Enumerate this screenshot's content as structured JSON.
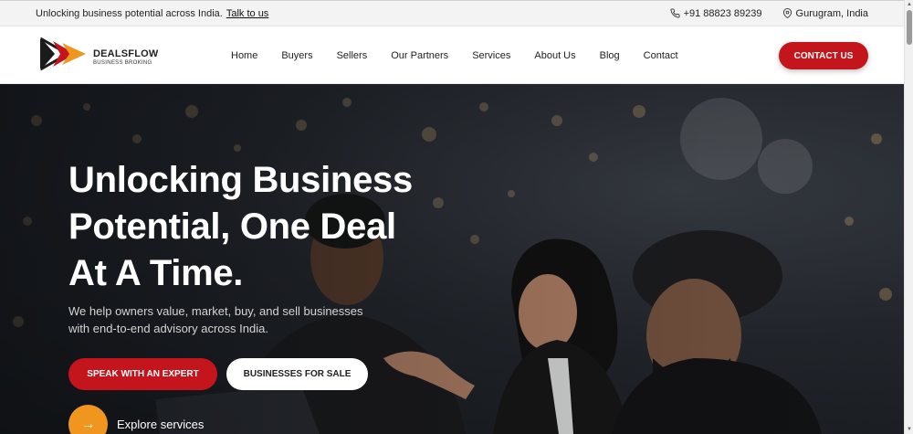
{
  "topbar": {
    "promo_text": "Unlocking business potential across India.",
    "promo_link": "Talk to us",
    "phone": "+91 88823 89239",
    "location": "Gurugram, India"
  },
  "navbar": {
    "brand_name": "DEALSFLOW",
    "brand_tagline": "BUSINESS BROKING",
    "links": [
      "Home",
      "Buyers",
      "Sellers",
      "Our Partners",
      "Services",
      "About Us",
      "Blog",
      "Contact"
    ],
    "contact_button": "CONTACT US"
  },
  "hero": {
    "headline": "Unlocking Business Potential, One Deal At A Time.",
    "subtext": "We help owners value, market, buy, and sell businesses with end-to-end advisory across India.",
    "primary_cta": "SPEAK WITH AN EXPERT",
    "secondary_cta": "BUSINESSES FOR SALE",
    "explore_label": "Explore services"
  },
  "icons": {
    "phone": "phone-icon",
    "location": "location-pin-icon",
    "arrow": "arrow-right-icon"
  },
  "colors": {
    "accent_red": "#c4151c",
    "accent_orange": "#f0961e",
    "topbar_bg": "#f3f3f3"
  }
}
